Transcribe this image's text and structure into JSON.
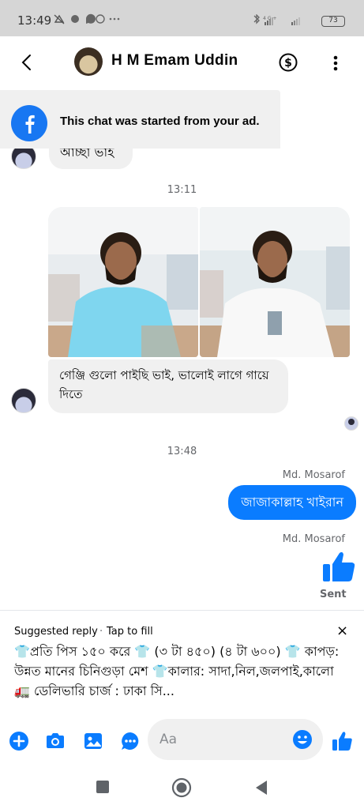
{
  "status_bar": {
    "time": "13:49",
    "battery": "73",
    "network": "4G+"
  },
  "header": {
    "contact_name": "H M Emam Uddin"
  },
  "ad_banner": {
    "text": "This chat was started from your ad."
  },
  "messages": {
    "cut_text": "আচ্ছা ভাই",
    "timestamp1": "13:11",
    "incoming_text": "গেঞ্জি গুলো পাইছি ভাই, ভালোই লাগে গায়ে দিতে",
    "timestamp2": "13:48",
    "sender1": "Md. Mosarof",
    "outgoing_text": "জাজাকাল্লাহ খাইরান",
    "sender2": "Md. Mosarof",
    "sent_status": "Sent"
  },
  "suggested_reply": {
    "title": "Suggested reply",
    "separator": "·",
    "tap": "Tap to fill",
    "close": "×",
    "text": "👕প্রতি পিস ১৫০ করে 👕 (৩ টা ৪৫০) (৪ টা ৬০০) 👕 কাপড়: উন্নত মানের চিনিগুড়া মেশ 👕কালার: সাদা,নিল,জলপাই,কালো 🚛 ডেলিভারি চার্জ : ঢাকা সি..."
  },
  "composer": {
    "placeholder": "Aa"
  },
  "colors": {
    "accent": "#0a7cff",
    "facebook": "#1877f2",
    "bubble_in": "#f0f0f0"
  }
}
